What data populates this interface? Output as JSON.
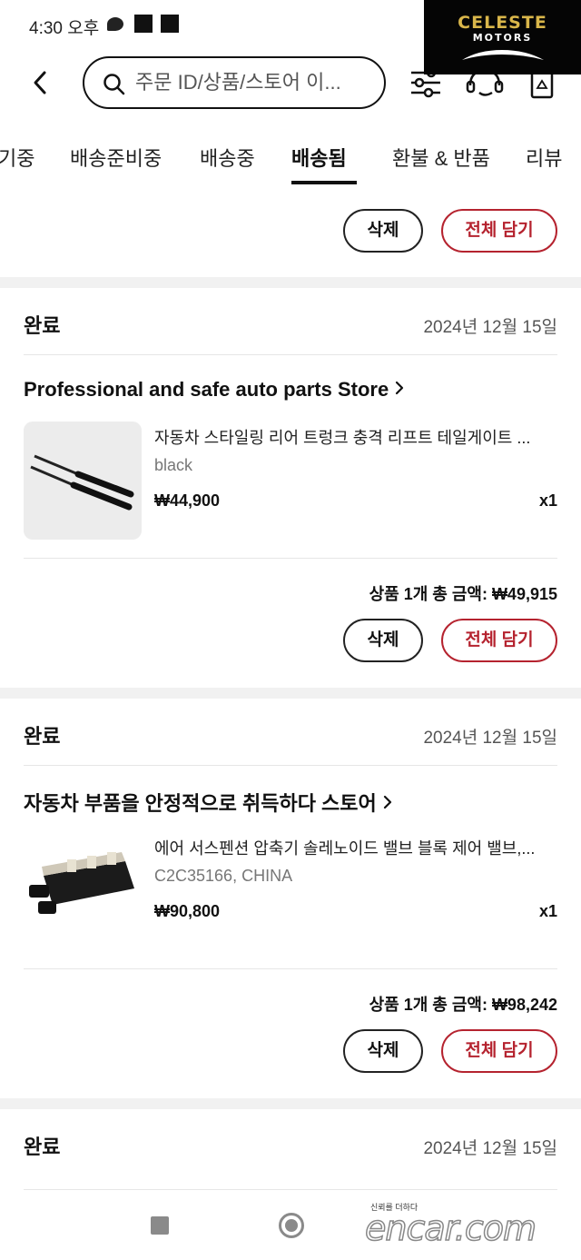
{
  "status_bar": {
    "time": "4:30 오후"
  },
  "brand": {
    "name": "CELESTE",
    "sub": "MOTORS"
  },
  "search": {
    "placeholder": "주문 ID/상품/스토어 이..."
  },
  "tabs": [
    {
      "label": "기중"
    },
    {
      "label": "배송준비중"
    },
    {
      "label": "배송중"
    },
    {
      "label": "배송됨",
      "active": true
    },
    {
      "label": "환불 & 반품"
    },
    {
      "label": "리뷰"
    }
  ],
  "buttons": {
    "delete": "삭제",
    "add_all": "전체 담기"
  },
  "orders": [
    {
      "status": "완료",
      "date": "2024년 12월 15일",
      "store": "Professional and safe auto parts Store",
      "item_title": "자동차 스타일링 리어 트렁크 충격 리프트 테일게이트 ...",
      "item_option": "black",
      "item_price": "₩44,900",
      "item_qty": "x1",
      "total": "상품 1개 총 금액: ₩49,915"
    },
    {
      "status": "완료",
      "date": "2024년 12월 15일",
      "store": "자동차 부품을 안정적으로 취득하다 스토어",
      "item_title": "에어 서스펜션 압축기 솔레노이드 밸브 블록 제어 밸브,...",
      "item_option": "C2C35166, CHINA",
      "item_price": "₩90,800",
      "item_qty": "x1",
      "total": "상품 1개 총 금액: ₩98,242"
    },
    {
      "status": "완료",
      "date": "2024년 12월 15일"
    }
  ],
  "watermark": {
    "small": "신뢰를 더하다",
    "text": "encar.com"
  },
  "colors": {
    "accent": "#b5232f",
    "brand_gold": "#d9b64a"
  }
}
